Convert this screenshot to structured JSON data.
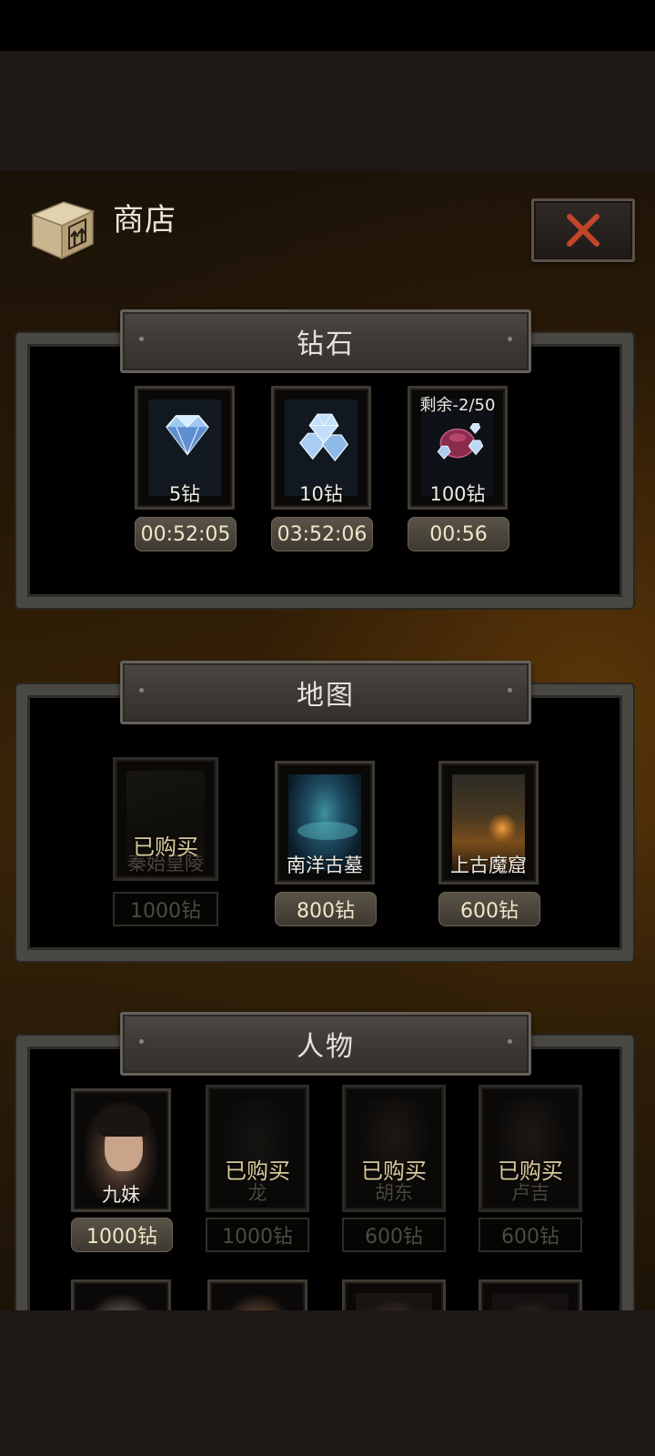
{
  "header": {
    "title": "商店"
  },
  "sections": {
    "diamonds": {
      "title": "钻石",
      "items": [
        {
          "label": "5钻",
          "timer": "00:52:05"
        },
        {
          "label": "10钻",
          "timer": "03:52:06"
        },
        {
          "label": "100钻",
          "timer": "00:56",
          "remaining": "剩余-2/50"
        }
      ]
    },
    "maps": {
      "title": "地图",
      "items": [
        {
          "name": "秦始皇陵",
          "price": "1000钻",
          "status": "已购买"
        },
        {
          "name": "南洋古墓",
          "price": "800钻"
        },
        {
          "name": "上古魔窟",
          "price": "600钻"
        }
      ]
    },
    "characters": {
      "title": "人物",
      "items": [
        {
          "name": "九妹",
          "price": "1000钻"
        },
        {
          "name": "龙",
          "price": "1000钻",
          "status": "已购买"
        },
        {
          "name": "胡东",
          "price": "600钻",
          "status": "已购买"
        },
        {
          "name": "卢吉",
          "price": "600钻",
          "status": "已购买"
        }
      ]
    }
  },
  "colors": {
    "accent_close": "#c2452a",
    "price_text": "#f1e6c8",
    "panel_border": "#4a4843"
  },
  "icons": [
    "shop-box-icon",
    "close-icon",
    "diamond-icon",
    "diamond-pile-icon",
    "diamond-bag-icon"
  ]
}
